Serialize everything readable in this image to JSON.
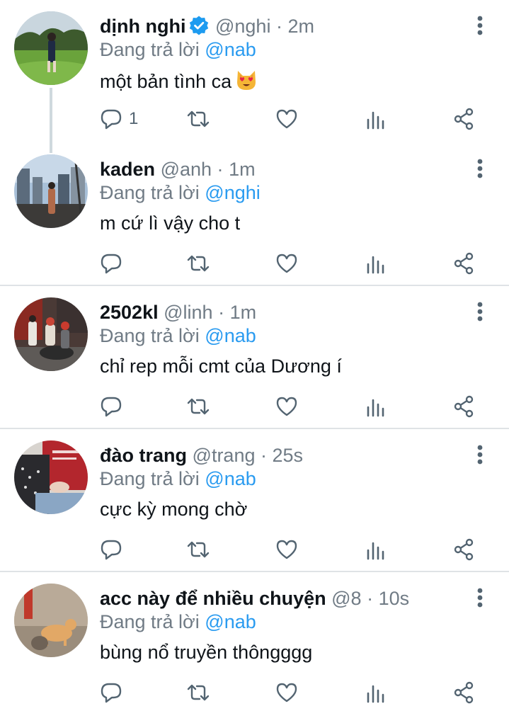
{
  "reply_to_label": "Đang trả lời",
  "tweets": [
    {
      "name": "dịnh nghi",
      "handle": "@nghi",
      "sep": "·",
      "time": "2m",
      "verified": true,
      "reply_to": "@nab",
      "text": "một bản tình ca",
      "emoji": "heart-eyes-cat",
      "reply_count": "1"
    },
    {
      "name": "kaden",
      "handle": "@anh",
      "sep": "·",
      "time": "1m",
      "verified": false,
      "reply_to": "@nghi",
      "text": "m cứ lì vậy cho t",
      "reply_count": ""
    },
    {
      "name": "2502kl",
      "handle": "@linh",
      "sep": "·",
      "time": "1m",
      "verified": false,
      "reply_to": "@nab",
      "text": "chỉ rep mỗi cmt của Dương í",
      "reply_count": ""
    },
    {
      "name": "đào trang",
      "handle": "@trang",
      "sep": "·",
      "time": "25s",
      "verified": false,
      "reply_to": "@nab",
      "text": "cực kỳ mong chờ",
      "reply_count": ""
    },
    {
      "name": "acc này để nhiều chuyện",
      "handle": "@8",
      "sep": "·",
      "time": "10s",
      "verified": false,
      "reply_to": "@nab",
      "text": "bùng nổ truyền thôngggg",
      "reply_count": ""
    }
  ],
  "colors": {
    "accent": "#1d9bf0",
    "secondary_text": "#707b85",
    "icon": "#536471",
    "divider": "#dfe3e6"
  },
  "icons": [
    "reply-icon",
    "retweet-icon",
    "like-icon",
    "views-icon",
    "share-icon",
    "more-icon",
    "verified-icon"
  ]
}
